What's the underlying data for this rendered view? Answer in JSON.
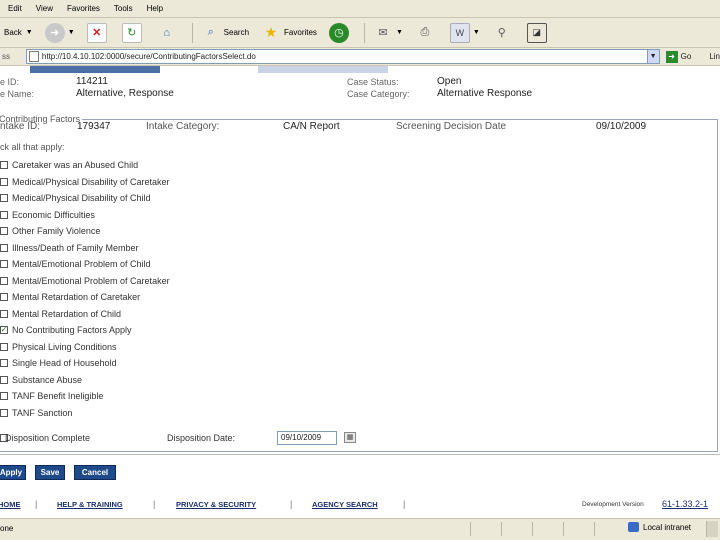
{
  "menu": [
    "Edit",
    "View",
    "Favorites",
    "Tools",
    "Help"
  ],
  "toolbar": {
    "back_label": "Back",
    "search_label": "Search",
    "favorites_label": "Favorites"
  },
  "address": {
    "label": "ss",
    "url": "http://10.4.10.102:0000/secure/ContributingFactorsSelect.do",
    "go_label": "Go",
    "links_label": "Lin"
  },
  "case": {
    "id_label": "e ID:",
    "id_value": "114211",
    "name_label": "e Name:",
    "name_value": "Alternative, Response",
    "status_label": "Case Status:",
    "status_value": "Open",
    "category_label": "Case Category:",
    "category_value": "Alternative Response"
  },
  "contributing": {
    "legend": "Contributing Factors",
    "intake_id_label": "ntake ID:",
    "intake_id_value": "179347",
    "intake_category_label": "Intake Category:",
    "intake_category_value": "CA/N Report",
    "screening_label": "Screening Decision Date",
    "screening_value": "09/10/2009",
    "check_title": "ck all that apply:",
    "factors": [
      {
        "label": "Caretaker was an Abused Child",
        "checked": false
      },
      {
        "label": "Medical/Physical Disability of Caretaker",
        "checked": false
      },
      {
        "label": "Medical/Physical Disability of Child",
        "checked": false
      },
      {
        "label": "Economic Difficulties",
        "checked": false
      },
      {
        "label": "Other Family Violence",
        "checked": false
      },
      {
        "label": "Illness/Death of Family Member",
        "checked": false
      },
      {
        "label": "Mental/Emotional Problem of Child",
        "checked": false
      },
      {
        "label": "Mental/Emotional Problem of Caretaker",
        "checked": false
      },
      {
        "label": "Mental Retardation of Caretaker",
        "checked": false
      },
      {
        "label": "Mental Retardation of Child",
        "checked": false
      },
      {
        "label": "No Contributing Factors Apply",
        "checked": true
      },
      {
        "label": "Physical Living Conditions",
        "checked": false
      },
      {
        "label": "Single Head of Household",
        "checked": false
      },
      {
        "label": "Substance Abuse",
        "checked": false
      },
      {
        "label": "TANF Benefit Ineligible",
        "checked": false
      },
      {
        "label": "TANF Sanction",
        "checked": false
      }
    ],
    "disposition_label": "Disposition Complete",
    "disposition_date_label": "Disposition Date:",
    "disposition_date_value": "09/10/2009"
  },
  "buttons": {
    "apply": "Apply",
    "save": "Save",
    "cancel": "Cancel"
  },
  "footer": {
    "home": "HOME",
    "help": "HELP & TRAINING",
    "privacy": "PRIVACY & SECURITY",
    "agency": "AGENCY SEARCH",
    "version_label": "Development Version",
    "version_value": "61-1.33.2-1"
  },
  "status": {
    "left": "one",
    "zone": "Local intranet"
  },
  "colors": {
    "button": "#1f4a8a",
    "footer_link": "#1a2e6e",
    "chrome": "#ece9d8",
    "check": "#1a7a1a"
  }
}
